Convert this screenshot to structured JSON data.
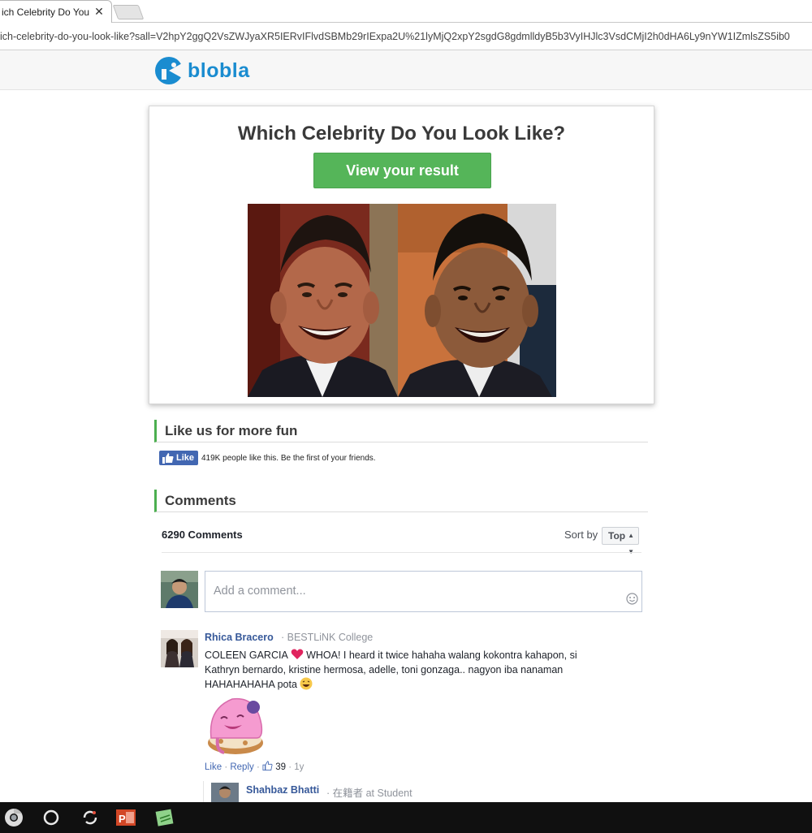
{
  "browser": {
    "tab_title": "ich Celebrity Do You L",
    "tab_close": "✕",
    "url": "ich-celebrity-do-you-look-like?sall=V2hpY2ggQ2VsZWJyaXR5IERvIFlvdSBMb29rIExpa2U%21lyMjQ2xpY2sgdG8gdmlldyB5b3VyIHJlc3VsdCMjI2h0dHA6Ly9nYW1IZmlsZS5ib0"
  },
  "site": {
    "logo_text": "blobla",
    "brand_color": "#1a8cd0"
  },
  "quiz": {
    "title": "Which Celebrity Do You Look Like?",
    "button_label": "View your result",
    "button_color": "#55b559"
  },
  "like_section": {
    "heading": "Like us for more fun",
    "like_button": "Like",
    "like_text": "419K people like this. Be the first of your friends."
  },
  "comments_section": {
    "heading": "Comments",
    "count_label": "6290 Comments",
    "sort_label": "Sort by",
    "sort_value": "Top",
    "input_placeholder": "Add a comment...",
    "comments": [
      {
        "name": "Rhica Bracero",
        "affiliation": "· BESTLiNK College",
        "text_part1": "COLEEN GARCIA",
        "text_part2": " WHOA! I heard it twice hahaha walang kokontra kahapon, si Kathryn bernardo, kristine hermosa, adelle, toni gonzaga.. nagyon iba nanaman HAHAHAHAHA pota ",
        "like_action": "Like",
        "reply_action": "Reply",
        "like_count": "39",
        "age": "1y"
      },
      {
        "name": "Shahbaz Bhatti",
        "affiliation": "· 在籍者 at Student"
      }
    ]
  },
  "taskbar": {
    "icons": [
      "chrome-icon",
      "cortana-icon",
      "sync-icon",
      "powerpoint-icon",
      "notes-icon"
    ]
  }
}
